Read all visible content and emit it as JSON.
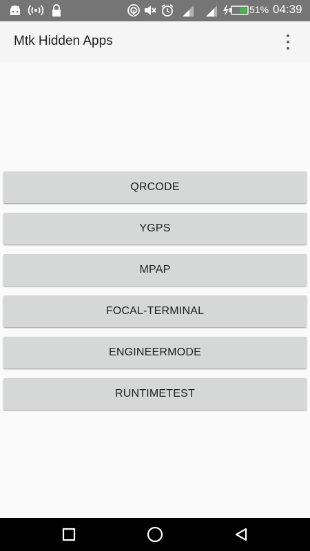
{
  "status_bar": {
    "battery_percent": "51%",
    "time": "04:39",
    "left_icons": [
      "android-icon",
      "hotspot-icon",
      "lock-icon"
    ],
    "right_icons": [
      "nfc-icon",
      "mute-icon",
      "alarm-icon",
      "signal-icon",
      "signal-icon",
      "charging-icon",
      "battery-icon"
    ]
  },
  "app_bar": {
    "title": "Mtk Hidden Apps",
    "menu_icon": "more-vert-icon"
  },
  "buttons": [
    {
      "label": "QRCODE"
    },
    {
      "label": "YGPS"
    },
    {
      "label": "MPAP"
    },
    {
      "label": "FOCAL-TERMINAL"
    },
    {
      "label": "ENGINEERMODE"
    },
    {
      "label": "RUNTIMETEST"
    }
  ],
  "nav_bar": {
    "icons": [
      "recents-icon",
      "home-icon",
      "back-icon"
    ]
  },
  "colors": {
    "status_bar": "#757575",
    "app_bar": "#f5f5f5",
    "background": "#fafafa",
    "button": "#d6d7d7",
    "battery_fill": "#4caf50",
    "nav_bar": "#000000"
  }
}
